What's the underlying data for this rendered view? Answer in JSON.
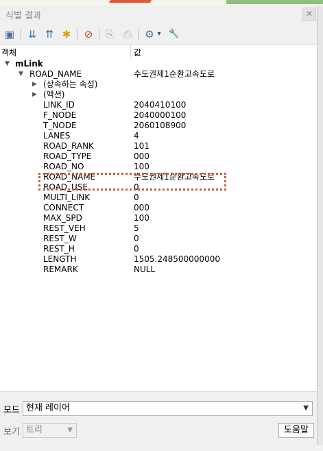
{
  "window": {
    "title": "식별 결과",
    "close": "✕"
  },
  "toolbar": {
    "icons": [
      "expand-tree-icon",
      "collapse-all-icon",
      "expand-all-icon",
      "expand-new-icon",
      "clear-results-icon",
      "copy-icon",
      "print-icon",
      "identify-settings-icon",
      "dropdown-icon",
      "wrench-icon"
    ],
    "glyphs": [
      "▣",
      "⇊",
      "⇈",
      "✱",
      "⊘",
      "⎘",
      "⎙",
      "⚙",
      "▾",
      "🔧"
    ]
  },
  "columns": {
    "object": "객체",
    "value": "값"
  },
  "tree": {
    "layer": "mLink",
    "feature_name": "ROAD_NAME",
    "feature_value": "수도권제1순환고속도로",
    "derived": "(상속하는 속성)",
    "actions": "(액션)",
    "attributes": [
      {
        "name": "LINK_ID",
        "value": "2040410100"
      },
      {
        "name": "F_NODE",
        "value": "2040000100"
      },
      {
        "name": "T_NODE",
        "value": "2060108900"
      },
      {
        "name": "LANES",
        "value": "4"
      },
      {
        "name": "ROAD_RANK",
        "value": "101"
      },
      {
        "name": "ROAD_TYPE",
        "value": "000"
      },
      {
        "name": "ROAD_NO",
        "value": "100"
      },
      {
        "name": "ROAD_NAME",
        "value": "수도권제1순환고속도로"
      },
      {
        "name": "ROAD_USE",
        "value": "0"
      },
      {
        "name": "MULTI_LINK",
        "value": "0"
      },
      {
        "name": "CONNECT",
        "value": "000"
      },
      {
        "name": "MAX_SPD",
        "value": "100"
      },
      {
        "name": "REST_VEH",
        "value": "5"
      },
      {
        "name": "REST_W",
        "value": "0"
      },
      {
        "name": "REST_H",
        "value": "0"
      },
      {
        "name": "LENGTH",
        "value": "1505.248500000000"
      },
      {
        "name": "REMARK",
        "value": "NULL"
      }
    ]
  },
  "bottom": {
    "mode_label": "모드",
    "mode_value": "현재 레이어",
    "view_label": "보기",
    "view_value": "트리",
    "help_label": "도움말"
  },
  "colors": {
    "highlight": "#c0603a"
  }
}
